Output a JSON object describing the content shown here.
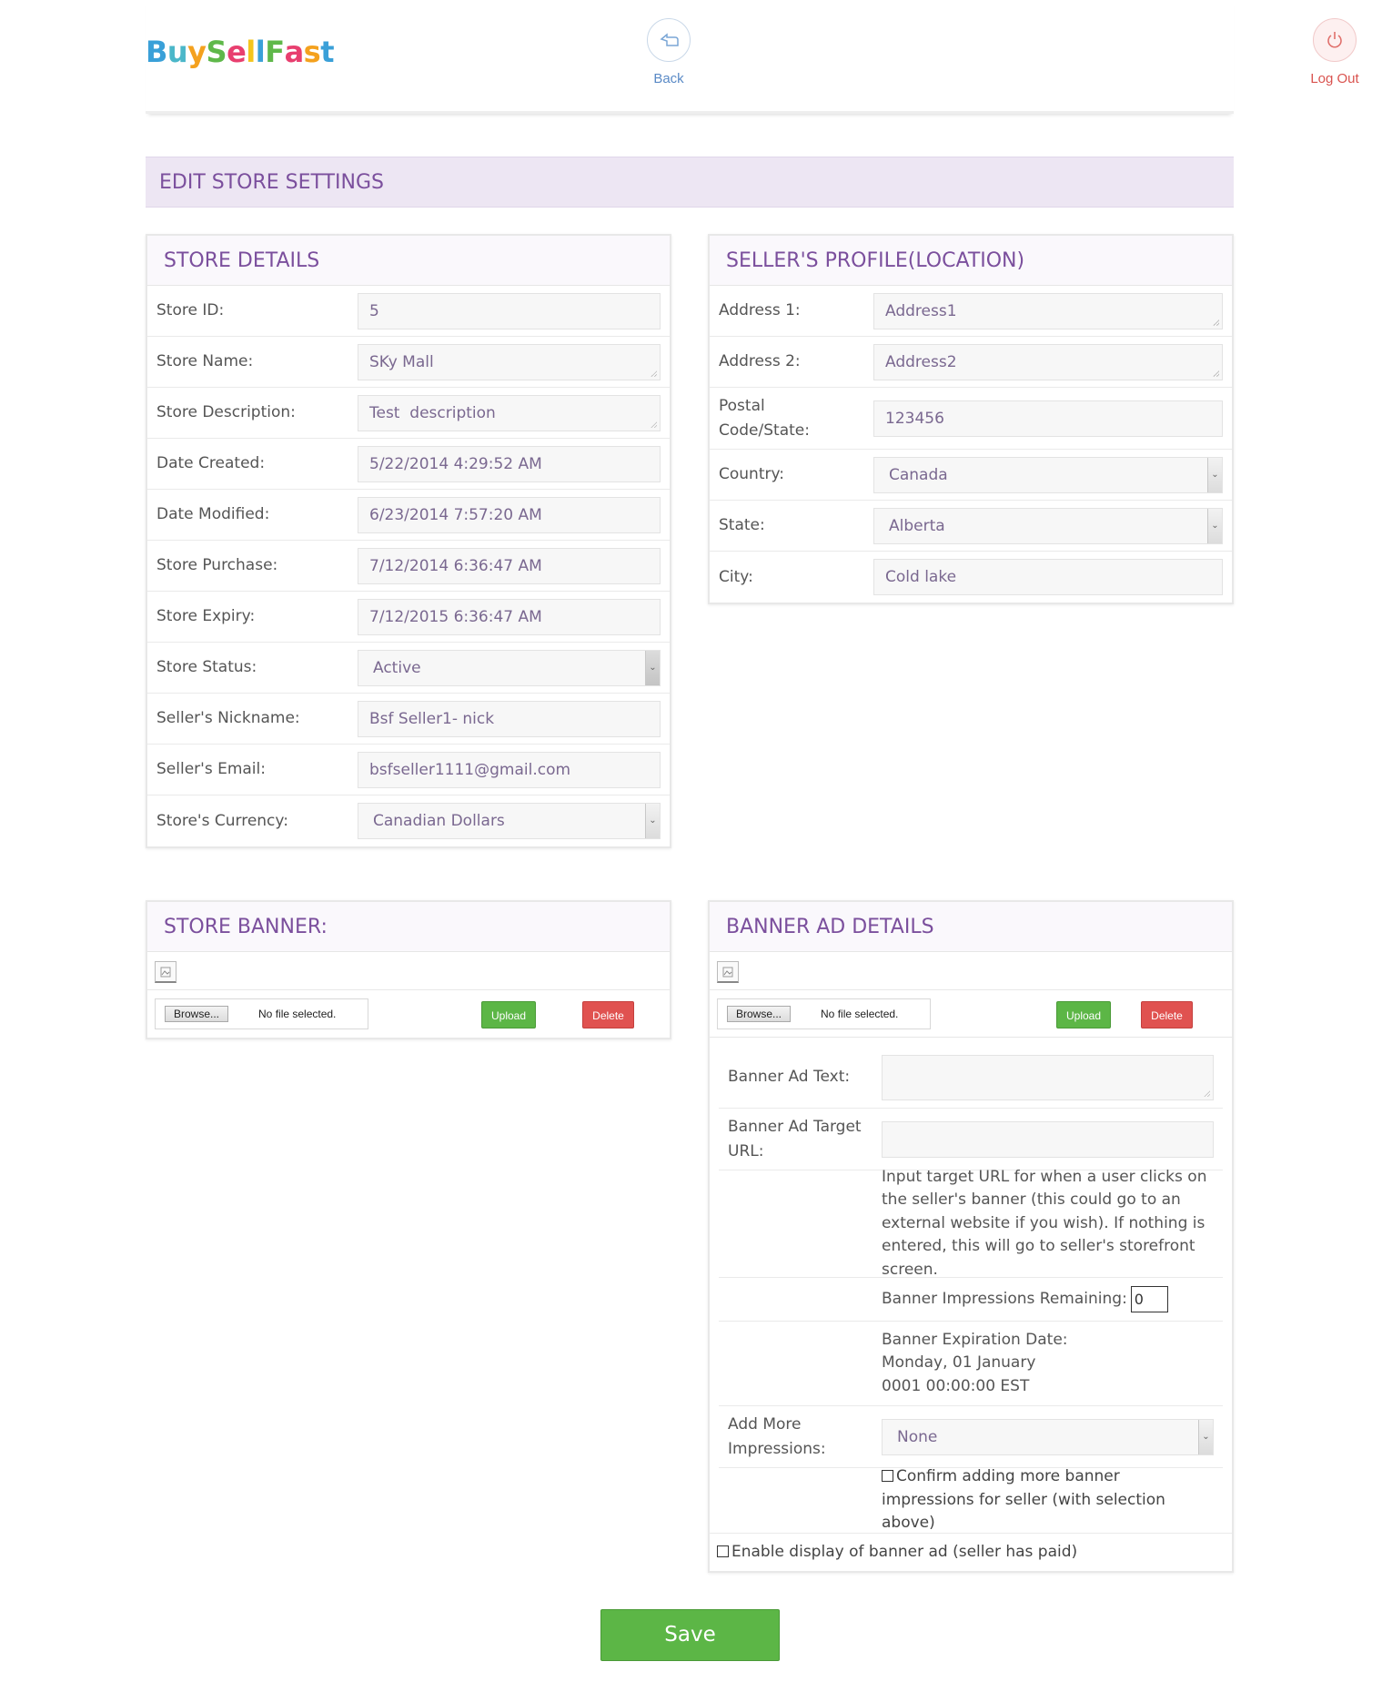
{
  "header": {
    "logo": "BuySellFast",
    "back_label": "Back",
    "logout_label": "Log Out"
  },
  "page_title": "EDIT STORE SETTINGS",
  "store_details": {
    "title": "STORE DETAILS",
    "rows": [
      {
        "label": "Store ID:",
        "value": "5"
      },
      {
        "label": "Store Name:",
        "value": "SKy Mall"
      },
      {
        "label": "Store Description:",
        "value": "Test  description"
      },
      {
        "label": "Date Created:",
        "value": "5/22/2014 4:29:52 AM"
      },
      {
        "label": "Date Modified:",
        "value": "6/23/2014 7:57:20 AM"
      },
      {
        "label": "Store Purchase:",
        "value": "7/12/2014 6:36:47 AM"
      },
      {
        "label": "Store Expiry:",
        "value": "7/12/2015 6:36:47 AM"
      },
      {
        "label": "Store Status:",
        "value": "Active"
      },
      {
        "label": "Seller's Nickname:",
        "value": "Bsf Seller1- nick"
      },
      {
        "label": "Seller's Email:",
        "value": "bsfseller1111@gmail.com"
      },
      {
        "label": "Store's Currency:",
        "value": "Canadian Dollars"
      }
    ]
  },
  "seller_profile": {
    "title": "SELLER'S PROFILE(LOCATION)",
    "rows": [
      {
        "label": "Address 1:",
        "value": "Address1"
      },
      {
        "label": "Address 2:",
        "value": "Address2"
      },
      {
        "label": "Postal Code/State:",
        "value": "123456"
      },
      {
        "label": "Country:",
        "value": "Canada"
      },
      {
        "label": "State:",
        "value": "Alberta"
      },
      {
        "label": "City:",
        "value": "Cold lake"
      }
    ]
  },
  "store_banner": {
    "title": "STORE BANNER:",
    "browse_label": "Browse...",
    "file_status": "No file selected.",
    "upload_label": "Upload",
    "delete_label": "Delete"
  },
  "banner_ad": {
    "title": "BANNER AD DETAILS",
    "browse_label": "Browse...",
    "file_status": "No file selected.",
    "upload_label": "Upload",
    "delete_label": "Delete",
    "text_label": "Banner Ad Text:",
    "text_value": "",
    "target_label": "Banner Ad Target URL:",
    "target_value": "",
    "help_text": "Input target URL for when a user clicks on the seller's banner (this could go to an external website if you wish). If nothing is entered, this will go to seller's storefront screen.",
    "impressions_label": "Banner Impressions Remaining:",
    "impressions_value": "0",
    "expiration_label": "Banner Expiration Date:",
    "expiration_value": "Monday, 01 January 0001 00:00:00 EST",
    "add_more_label": "Add More Impressions:",
    "add_more_value": "None",
    "confirm_label": "Confirm adding more banner impressions for seller (with selection above)",
    "enable_label": "Enable display of banner ad (seller has paid)"
  },
  "save_label": "Save",
  "colors": {
    "accent_purple": "#7b4f9d",
    "title_bar_bg": "#ede6f3",
    "green": "#5cb646",
    "red": "#e05250"
  }
}
